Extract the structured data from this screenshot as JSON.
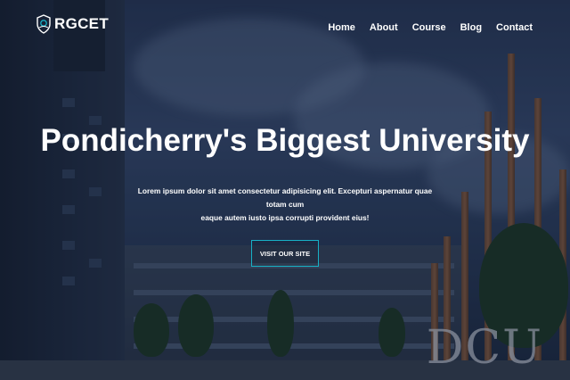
{
  "brand": {
    "name": "RGCET",
    "icon": "college-emblem-icon"
  },
  "nav": {
    "items": [
      {
        "label": "Home"
      },
      {
        "label": "About"
      },
      {
        "label": "Course"
      },
      {
        "label": "Blog"
      },
      {
        "label": "Contact"
      }
    ]
  },
  "hero": {
    "title": "Pondicherry's Biggest University",
    "subtitle_line1": "Lorem ipsum dolor sit amet consectetur adipisicing elit. Excepturi aspernatur quae totam cum",
    "subtitle_line2": "eaque autem iusto ipsa corrupti provident eius!",
    "cta_label": "VISIT OUR SITE",
    "background_sign": "DCU"
  },
  "colors": {
    "accent": "#17b1c6",
    "text": "#ffffff"
  }
}
